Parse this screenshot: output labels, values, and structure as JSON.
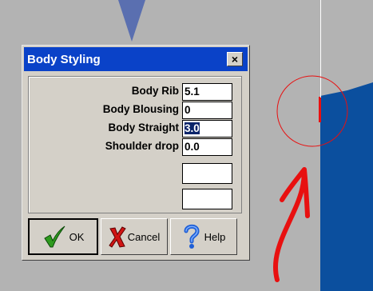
{
  "dialog": {
    "title": "Body Styling",
    "close_glyph": "×",
    "fields": [
      {
        "label": "Body Rib",
        "value": "5.1"
      },
      {
        "label": "Body Blousing",
        "value": "0"
      },
      {
        "label": "Body Straight",
        "value": "3.0"
      },
      {
        "label": "Shoulder drop",
        "value": "0.0"
      },
      {
        "label": "",
        "value": ""
      },
      {
        "label": "",
        "value": ""
      }
    ],
    "buttons": {
      "ok": "OK",
      "cancel": "Cancel",
      "help": "Help"
    }
  },
  "colors": {
    "titlebar": "#0a42c8",
    "canvas_blue": "#0b4f9e",
    "annotation_red": "#e81010"
  },
  "icons": {
    "ok": "checkmark-icon",
    "cancel": "x-icon",
    "help": "question-mark-icon"
  }
}
